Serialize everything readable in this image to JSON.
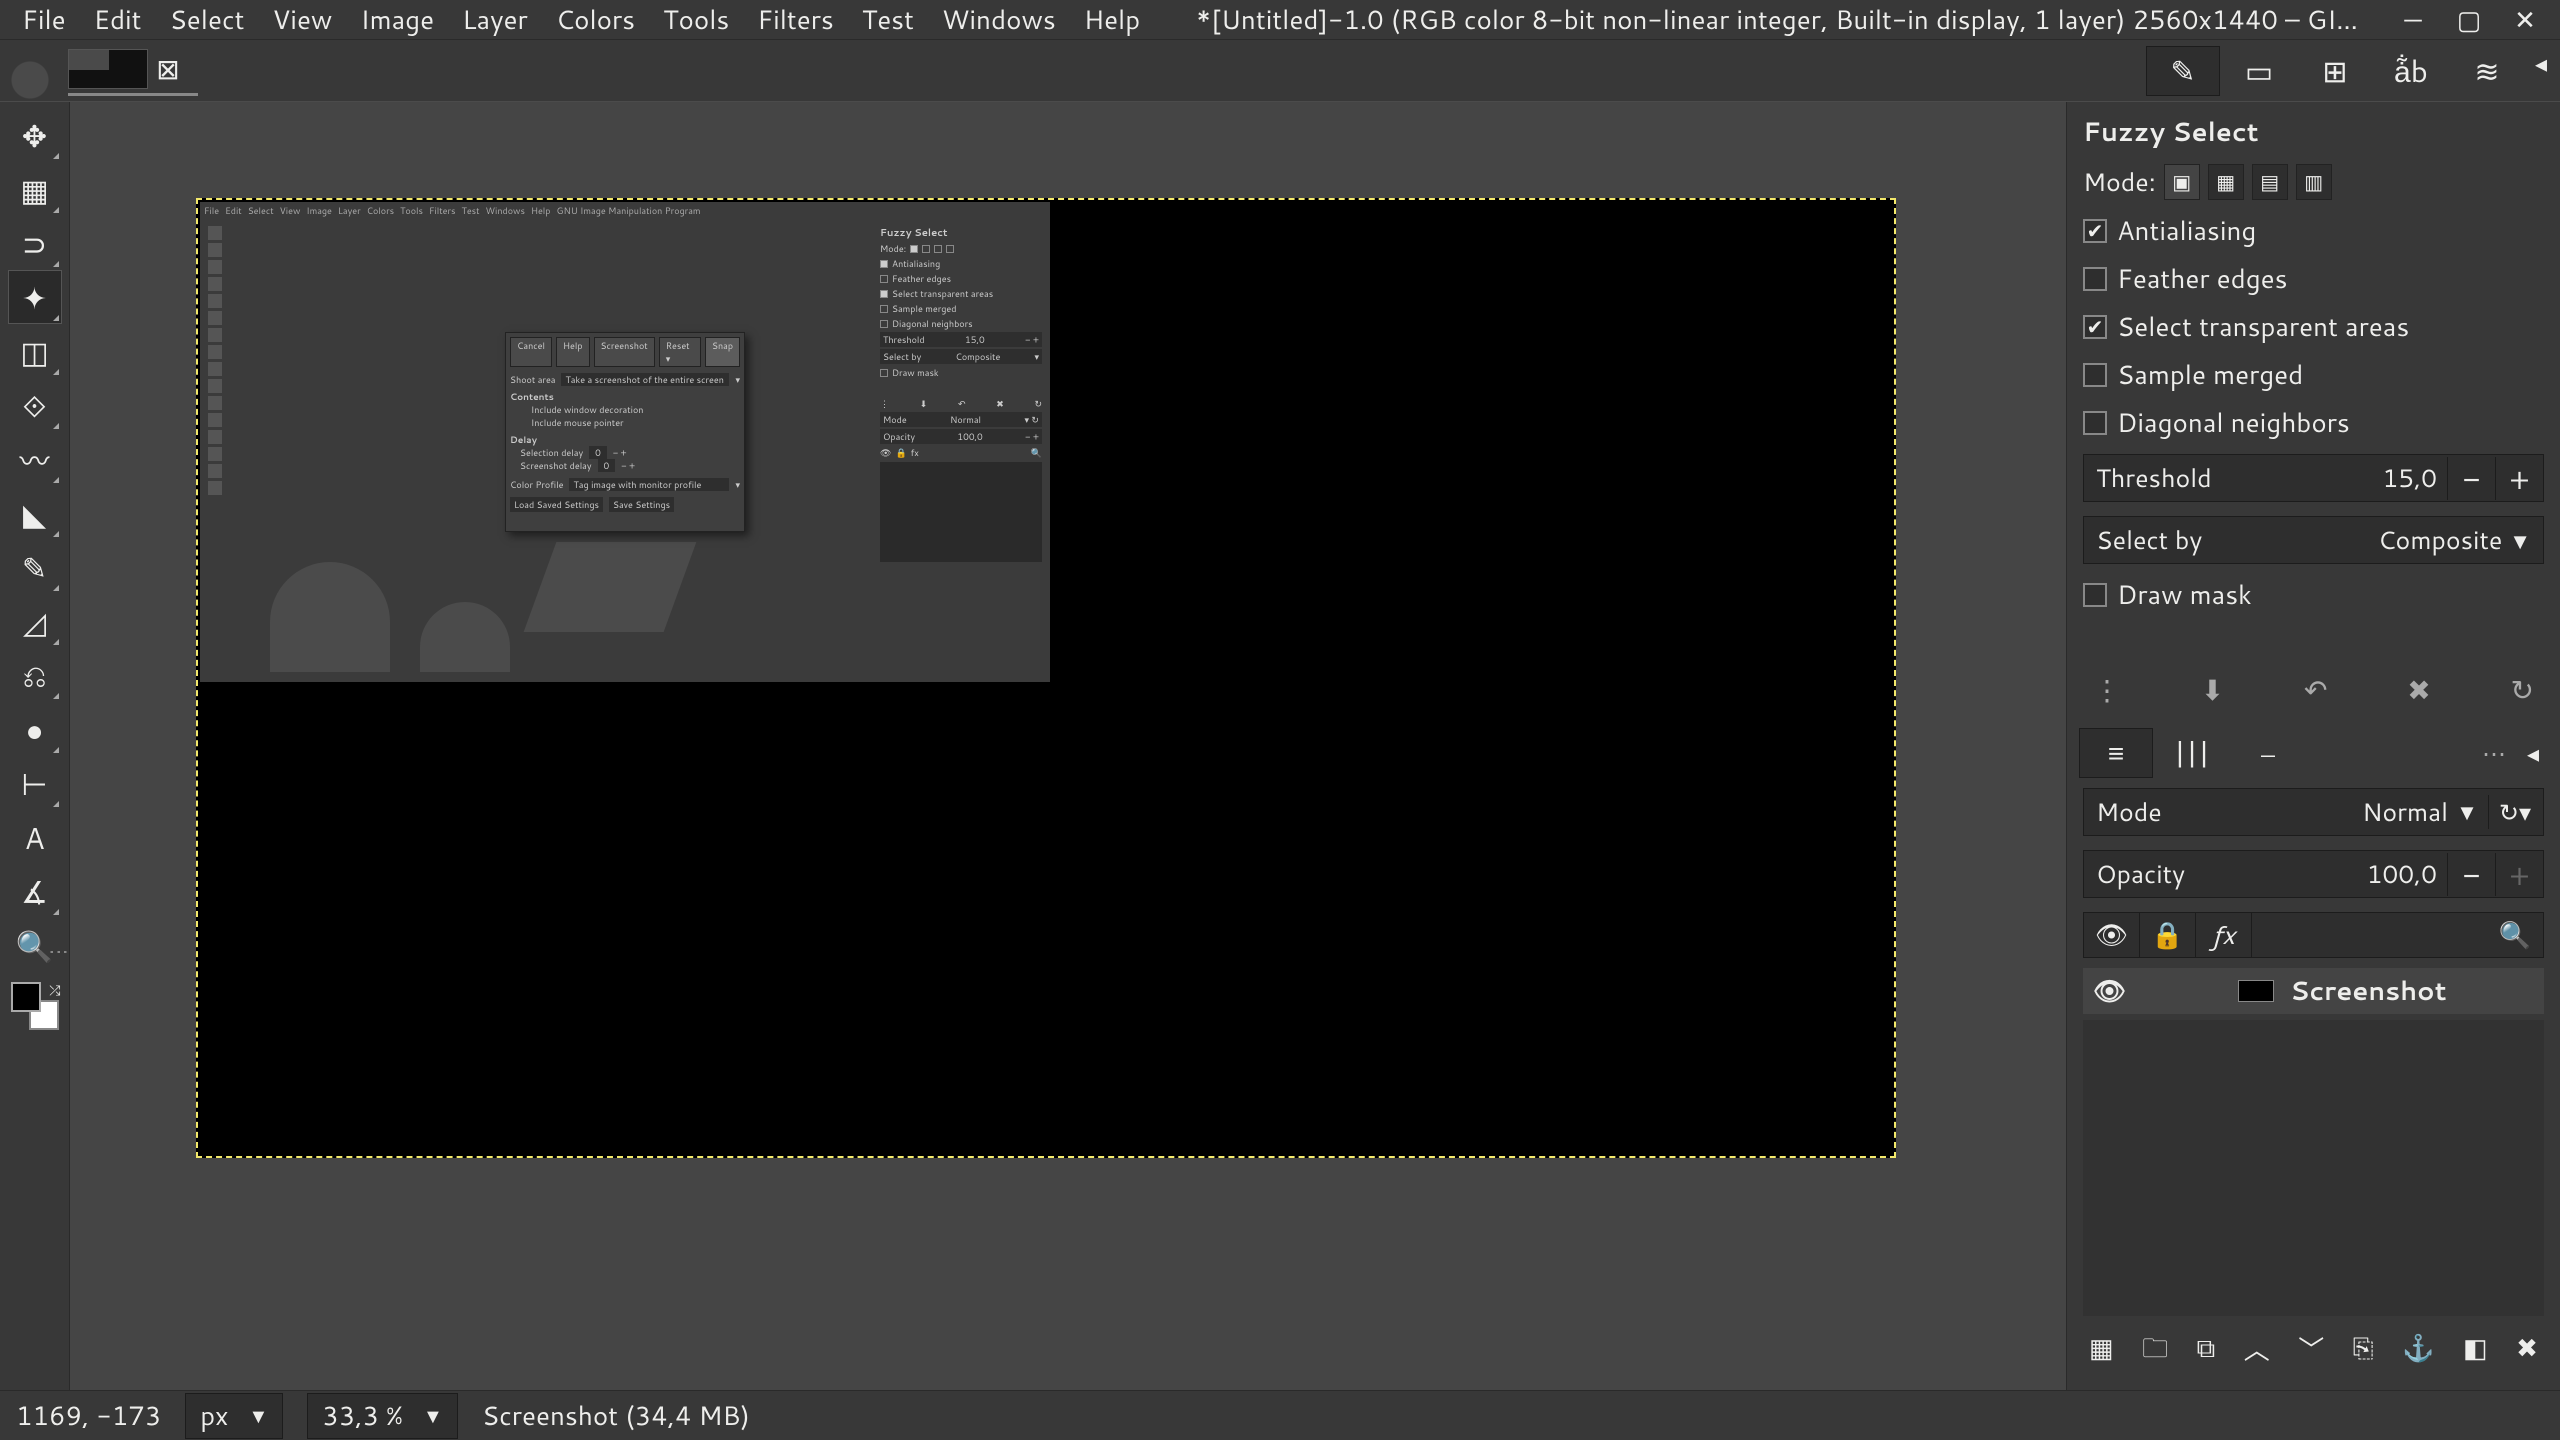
{
  "menubar": {
    "items": [
      "File",
      "Edit",
      "Select",
      "View",
      "Image",
      "Layer",
      "Colors",
      "Tools",
      "Filters",
      "Test",
      "Windows",
      "Help"
    ],
    "title": "*[Untitled]-1.0 (RGB color 8-bit non-linear integer, Built-in display, 1 layer) 2560x1440 – GI…"
  },
  "window_controls": {
    "minimize": "—",
    "maximize": "▢",
    "close": "✕"
  },
  "toolbox": {
    "tools": [
      {
        "name": "move-tool",
        "glyph": "✥"
      },
      {
        "name": "rect-select-tool",
        "glyph": "▦"
      },
      {
        "name": "free-select-tool",
        "glyph": "⊃"
      },
      {
        "name": "fuzzy-select-tool",
        "glyph": "✦",
        "active": true
      },
      {
        "name": "crop-tool",
        "glyph": "◫"
      },
      {
        "name": "transform-tool",
        "glyph": "⟐"
      },
      {
        "name": "warp-tool",
        "glyph": "〰"
      },
      {
        "name": "bucket-fill-tool",
        "glyph": "◣"
      },
      {
        "name": "paintbrush-tool",
        "glyph": "✎"
      },
      {
        "name": "eraser-tool",
        "glyph": "◿"
      },
      {
        "name": "clone-tool",
        "glyph": "⎌"
      },
      {
        "name": "smudge-tool",
        "glyph": "●"
      },
      {
        "name": "paths-tool",
        "glyph": "⊢"
      },
      {
        "name": "text-tool",
        "glyph": "A"
      },
      {
        "name": "measure-tool",
        "glyph": "∡"
      },
      {
        "name": "zoom-tool",
        "glyph": "🔍"
      }
    ],
    "more_glyph": "⋮"
  },
  "tool_options": {
    "title": "Fuzzy Select",
    "mode_label": "Mode:",
    "modes": [
      {
        "name": "mode-replace",
        "glyph": "▣",
        "active": true
      },
      {
        "name": "mode-add",
        "glyph": "▦"
      },
      {
        "name": "mode-sub",
        "glyph": "▤"
      },
      {
        "name": "mode-intersect",
        "glyph": "▥"
      }
    ],
    "antialiasing": {
      "label": "Antialiasing",
      "checked": true
    },
    "feather": {
      "label": "Feather edges",
      "checked": false
    },
    "select_transparent": {
      "label": "Select transparent areas",
      "checked": true
    },
    "sample_merged": {
      "label": "Sample merged",
      "checked": false
    },
    "diagonal": {
      "label": "Diagonal neighbors",
      "checked": false
    },
    "threshold": {
      "label": "Threshold",
      "value": "15,0"
    },
    "select_by": {
      "label": "Select by",
      "value": "Composite"
    },
    "draw_mask": {
      "label": "Draw mask",
      "checked": false
    },
    "action_icons": {
      "menu": "⋮",
      "save": "⬇",
      "undo": "↶",
      "delete": "✖",
      "reset": "↻"
    }
  },
  "dock_tabs": [
    {
      "name": "tool-options-tab",
      "glyph": "✎",
      "active": true
    },
    {
      "name": "device-status-tab",
      "glyph": "▭"
    },
    {
      "name": "symmetry-tab",
      "glyph": "⊞"
    },
    {
      "name": "text-tab",
      "glyph": "a͋b"
    },
    {
      "name": "history-tab",
      "glyph": "≋"
    }
  ],
  "layers_dock": {
    "tabs": [
      {
        "name": "layers-tab",
        "glyph": "≡",
        "active": true
      },
      {
        "name": "channels-tab",
        "glyph": "|||"
      },
      {
        "name": "paths-tab",
        "glyph": "⎯"
      }
    ],
    "mode": {
      "label": "Mode",
      "value": "Normal"
    },
    "opacity": {
      "label": "Opacity",
      "value": "100,0"
    },
    "header_icons": {
      "eye": "👁",
      "lock": "🔒",
      "fx": "fx",
      "search": "🔍"
    },
    "layer": {
      "eye": "👁",
      "name": "Screenshot"
    },
    "buttons": [
      {
        "name": "new-layer",
        "glyph": "▦"
      },
      {
        "name": "new-group",
        "glyph": "🗀"
      },
      {
        "name": "duplicate-layer",
        "glyph": "⧉"
      },
      {
        "name": "raise-layer",
        "glyph": "︿"
      },
      {
        "name": "lower-layer",
        "glyph": "﹀"
      },
      {
        "name": "merge-down",
        "glyph": "⎘"
      },
      {
        "name": "anchor-layer",
        "glyph": "⚓"
      },
      {
        "name": "mask-layer",
        "glyph": "◧"
      },
      {
        "name": "delete-layer",
        "glyph": "✖"
      }
    ]
  },
  "statusbar": {
    "coords": "1169, -173",
    "unit": "px",
    "zoom": "33,3 %",
    "info": "Screenshot (34,4 MB)"
  },
  "embedded": {
    "menubar": [
      "File",
      "Edit",
      "Select",
      "View",
      "Image",
      "Layer",
      "Colors",
      "Tools",
      "Filters",
      "Test",
      "Windows",
      "Help",
      "     GNU Image Manipulation Program"
    ],
    "fuzzy_title": "Fuzzy Select",
    "options": [
      {
        "label": "Antialiasing",
        "checked": true
      },
      {
        "label": "Feather edges",
        "checked": false
      },
      {
        "label": "Select transparent areas",
        "checked": true
      },
      {
        "label": "Sample merged",
        "checked": false
      },
      {
        "label": "Diagonal neighbors",
        "checked": false
      }
    ],
    "threshold": {
      "label": "Threshold",
      "value": "15,0"
    },
    "select_by": {
      "label": "Select by",
      "value": "Composite"
    },
    "draw_mask": "Draw mask",
    "layers": {
      "mode": "Mode",
      "mode_val": "Normal",
      "opacity": "Opacity",
      "opacity_val": "100,0"
    },
    "dialog": {
      "buttons": [
        "Cancel",
        "Help",
        "Screenshot",
        "Reset ▾",
        "Snap"
      ],
      "shoot_area_label": "Shoot area",
      "shoot_area_value": "Take a screenshot of the entire screen",
      "contents": "Contents",
      "include_decoration": "Include window decoration",
      "include_pointer": "Include mouse pointer",
      "delay": "Delay",
      "selection_delay": "Selection delay",
      "screenshot_delay": "Screenshot delay",
      "zero": "0",
      "color_profile_label": "Color Profile",
      "color_profile_value": "Tag image with monitor profile",
      "load_saved": "Load Saved Settings",
      "save_settings": "Save Settings"
    }
  }
}
